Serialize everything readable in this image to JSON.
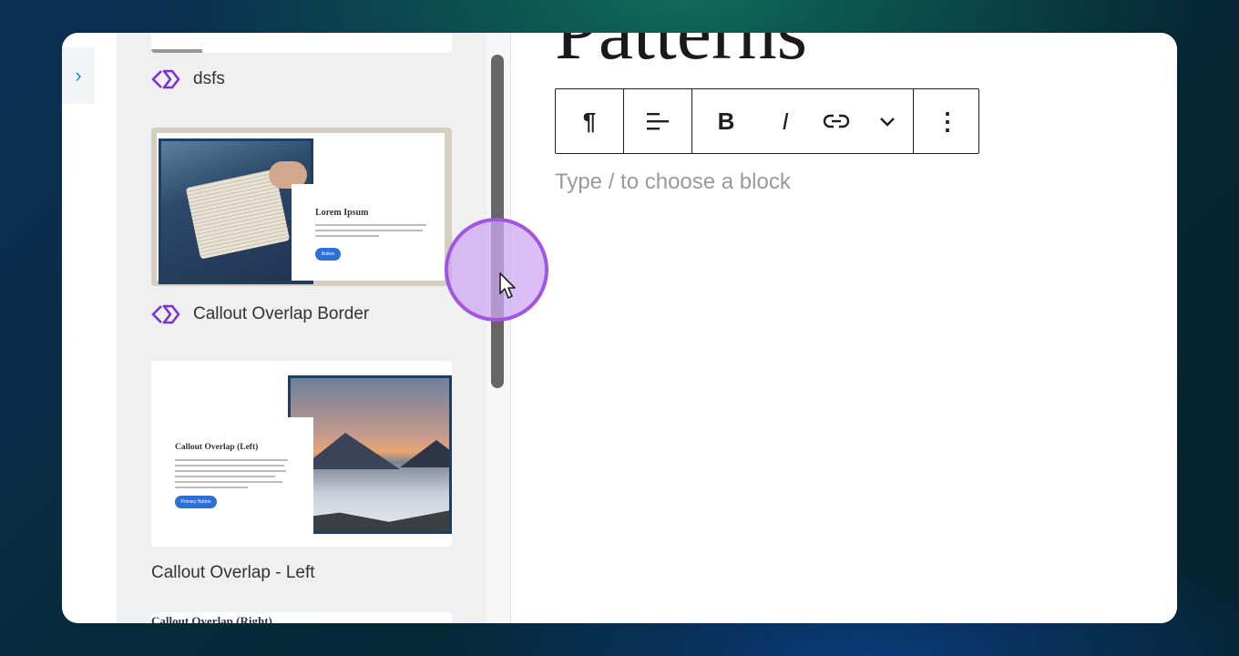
{
  "editor": {
    "title": "Patterns",
    "placeholder": "Type / to choose a block",
    "toolbar": {
      "paragraph_icon": "¶",
      "bold_label": "B",
      "italic_label": "I",
      "more_icon": "⋮"
    }
  },
  "patterns": [
    {
      "label": "dsfs",
      "icon": "synced-pattern-icon"
    },
    {
      "label": "Callout Overlap Border",
      "icon": "synced-pattern-icon",
      "preview": {
        "title": "Lorem Ipsum",
        "button": "Button"
      }
    },
    {
      "label": "Callout Overlap - Left",
      "preview": {
        "title": "Callout Overlap (Left)",
        "button": "Primary Button"
      }
    },
    {
      "preview": {
        "title": "Callout Overlap (Right)"
      }
    }
  ],
  "colors": {
    "accent_purple": "#7b2fd6",
    "primary_button": "#2f6fd8",
    "expand_chevron": "#2a8ac8"
  },
  "sidebar": {
    "expand_icon": "›"
  }
}
